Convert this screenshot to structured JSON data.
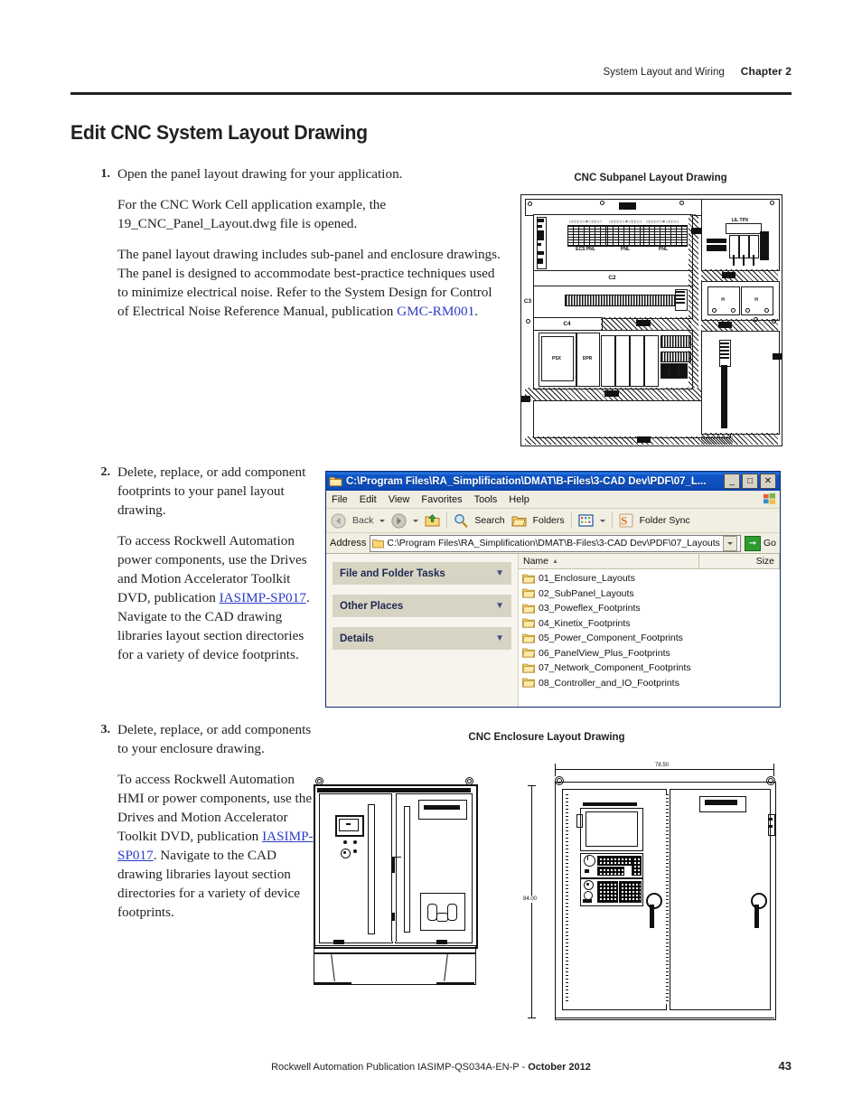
{
  "header": {
    "section": "System Layout and Wiring",
    "chapter": "Chapter 2"
  },
  "title": "Edit CNC System Layout Drawing",
  "steps": [
    {
      "number": "1.",
      "paragraphs": [
        "Open the panel layout drawing for your application.",
        "For the CNC Work Cell application example, the 19_CNC_Panel_Layout.dwg file is opened."
      ],
      "para3_before": "The panel layout drawing includes sub-panel and enclosure drawings. The panel is designed to accommodate best-practice techniques used to minimize electrical noise. Refer to the System Design for Control of Electrical Noise Reference Manual, publication ",
      "link": "GMC-RM001",
      "para3_after": "."
    },
    {
      "number": "2.",
      "paragraphs": [
        "Delete, replace, or add component footprints to your panel layout drawing."
      ],
      "para2_before": "To access Rockwell Automation power components, use the Drives and Motion Accelerator Toolkit DVD, publication ",
      "link": "IASIMP-SP017",
      "para2_after": ". Navigate to the CAD drawing libraries layout section directories for a variety of device footprints."
    },
    {
      "number": "3.",
      "paragraphs": [
        "Delete, replace, or add components to your enclosure drawing."
      ],
      "para2_before": "To access Rockwell Automation HMI or power components, use the Drives and Motion Accelerator Toolkit DVD, publication ",
      "link": "IASIMP-SP017",
      "para2_after": ". Navigate to the CAD drawing libraries layout section directories for a variety of device footprints."
    }
  ],
  "figures": {
    "subpanel_caption": "CNC Subpanel Layout Drawing",
    "enclosure_caption": "CNC Enclosure Layout Drawing",
    "subpanel_labels": {
      "c2": "C2",
      "c3": "C3",
      "c4": "C4"
    },
    "enclosure_dims": {
      "width": "78.50",
      "height": "84.00"
    }
  },
  "explorer": {
    "title": "C:\\Program Files\\RA_Simplification\\DMAT\\B-Files\\3-CAD Dev\\PDF\\07_L...",
    "window_buttons": {
      "minimize": "_",
      "maximize": "□",
      "close": "✕"
    },
    "menu": [
      "File",
      "Edit",
      "View",
      "Favorites",
      "Tools",
      "Help"
    ],
    "toolbar": {
      "back": "Back",
      "forward": "",
      "up": "",
      "search": "Search",
      "folders": "Folders",
      "views": "",
      "folder_sync": "Folder Sync"
    },
    "address": {
      "label": "Address",
      "value": "C:\\Program Files\\RA_Simplification\\DMAT\\B-Files\\3-CAD Dev\\PDF\\07_Layouts",
      "go": "Go"
    },
    "side_panels": [
      "File and Folder Tasks",
      "Other Places",
      "Details"
    ],
    "columns": {
      "name": "Name",
      "size": "Size"
    },
    "folders": [
      "01_Enclosure_Layouts",
      "02_SubPanel_Layouts",
      "03_Poweflex_Footprints",
      "04_Kinetix_Footprints",
      "05_Power_Component_Footprints",
      "06_PanelView_Plus_Footprints",
      "07_Network_Component_Footprints",
      "08_Controller_and_IO_Footprints"
    ]
  },
  "footer": {
    "publication": "Rockwell Automation Publication IASIMP-QS034A-EN-P",
    "date": "October 2012",
    "page": "43"
  },
  "colors": {
    "link": "#2a3cc8",
    "title_bar": "#0b53c4",
    "ink": "#231f20"
  }
}
